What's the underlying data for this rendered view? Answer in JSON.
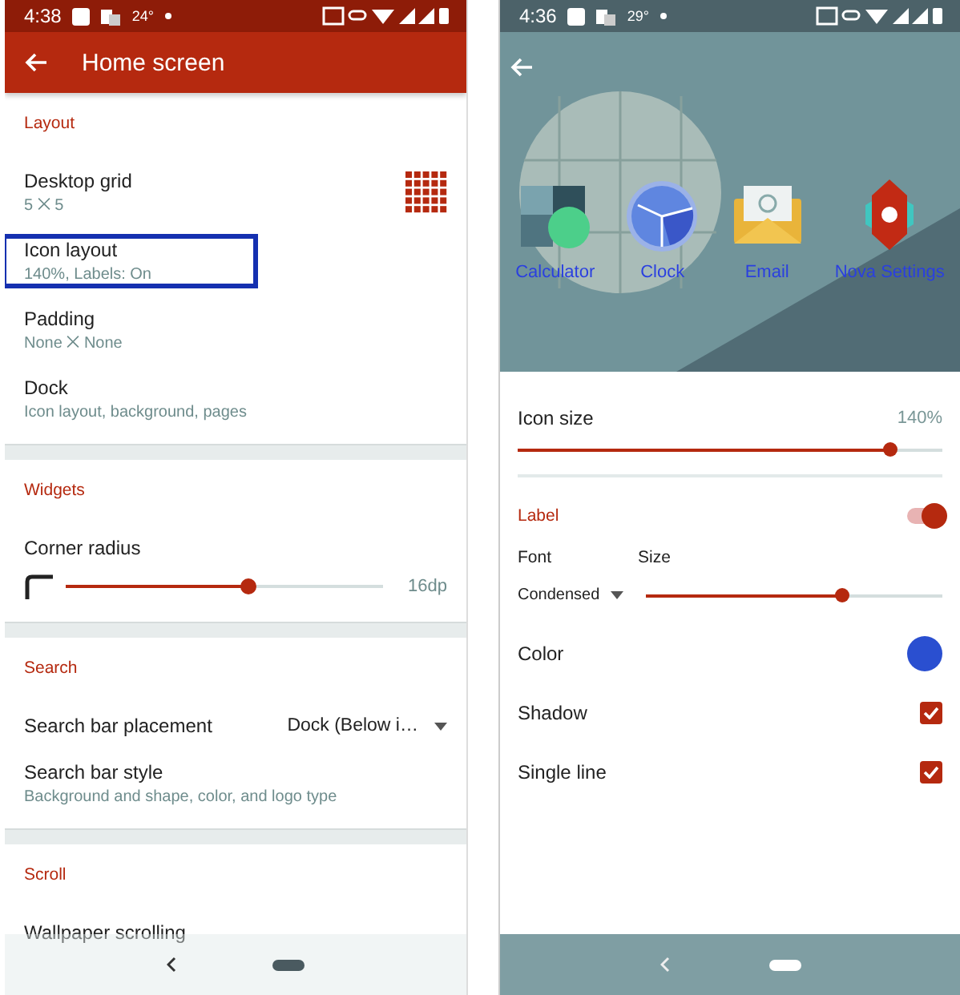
{
  "left_screen": {
    "status_bar": {
      "time": "4:38",
      "temperature": "24°"
    },
    "app_bar": {
      "title": "Home screen"
    },
    "sections": [
      {
        "title": "Layout",
        "items": [
          {
            "kind": "grid",
            "title": "Desktop grid",
            "subtitle": "5 ⨉ 5"
          },
          {
            "kind": "text",
            "title": "Icon layout",
            "subtitle": "140%, Labels: On",
            "highlighted": true
          },
          {
            "kind": "text",
            "title": "Padding",
            "subtitle": "None ⨉ None"
          },
          {
            "kind": "text",
            "title": "Dock",
            "subtitle": "Icon layout, background, pages"
          }
        ]
      },
      {
        "title": "Widgets",
        "items": [
          {
            "kind": "slider",
            "title": "Corner radius",
            "level": 0.575,
            "reading": "16dp"
          }
        ]
      },
      {
        "title": "Search",
        "items": [
          {
            "kind": "dropdown",
            "title": "Search bar placement",
            "value": "Dock (Below i…"
          },
          {
            "kind": "text",
            "title": "Search bar style",
            "subtitle": "Background and shape, color, and logo type"
          }
        ]
      },
      {
        "title": "Scroll",
        "items": [
          {
            "kind": "text",
            "title": "Wallpaper scrolling"
          }
        ]
      }
    ]
  },
  "right_screen": {
    "status_bar": {
      "time": "4:36",
      "temperature": "29°"
    },
    "preview_apps": [
      "Calculator",
      "Clock",
      "Email",
      "Nova Settings"
    ],
    "icon_size": {
      "title": "Icon size",
      "reading": "140%",
      "level": 0.875
    },
    "label": {
      "title": "Label",
      "on": true,
      "font_heading": "Font",
      "size_heading": "Size",
      "font_value": "Condensed",
      "size_slider": {
        "level": 0.66
      }
    },
    "options": [
      {
        "kind": "color",
        "title": "Color",
        "color": "#2a4fd0"
      },
      {
        "kind": "checkbox",
        "title": "Shadow",
        "checked": true
      },
      {
        "kind": "checkbox",
        "title": "Single line",
        "checked": true
      }
    ]
  }
}
